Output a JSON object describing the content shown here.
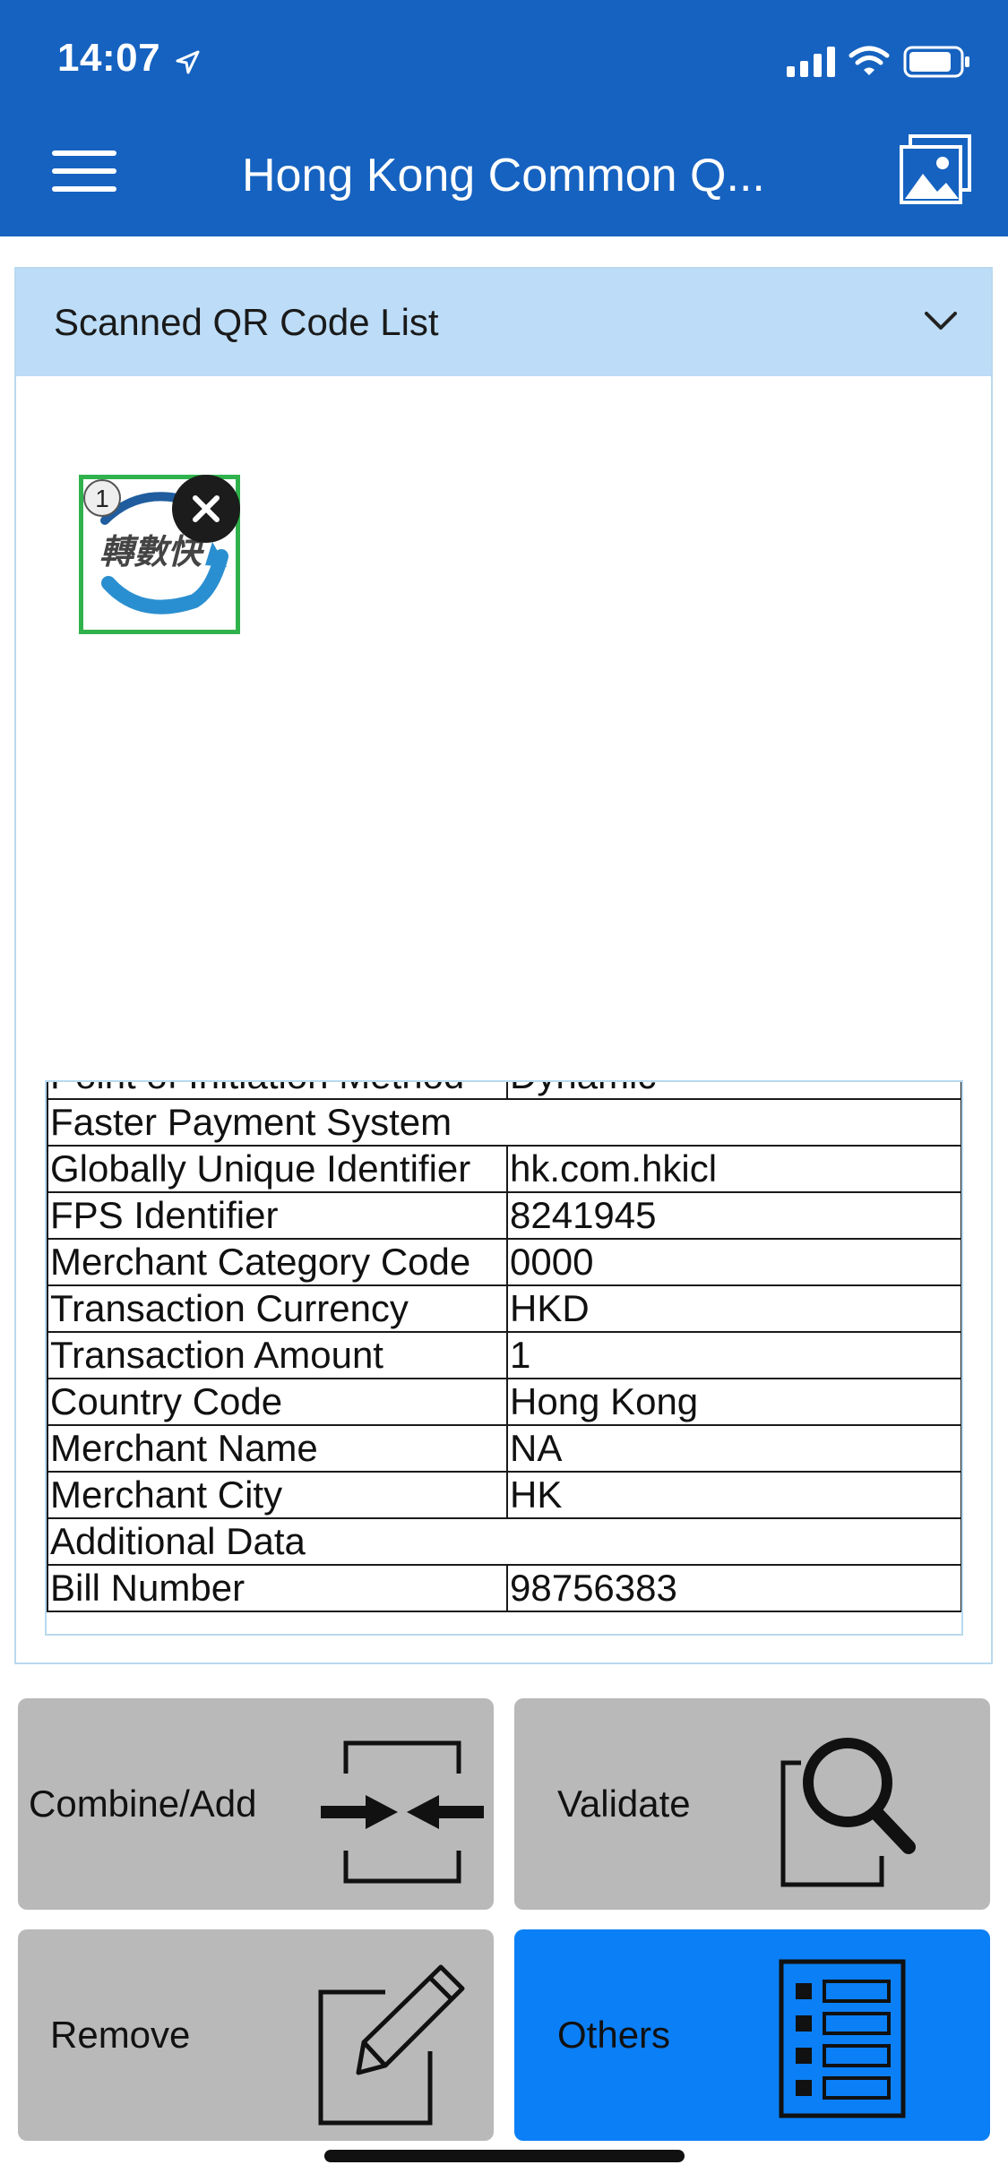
{
  "status_bar": {
    "time": "14:07"
  },
  "nav": {
    "title": "Hong Kong Common Q..."
  },
  "panel": {
    "title": "Scanned QR Code List"
  },
  "thumbnails": [
    {
      "index": "1",
      "logo_text": "轉數快"
    }
  ],
  "table": {
    "partial_row": {
      "label": "Point of Initiation Method",
      "value": "Dynamic"
    },
    "rows": [
      {
        "label": "Faster Payment System",
        "value": ""
      },
      {
        "label": "Globally Unique Identifier",
        "value": "hk.com.hkicl"
      },
      {
        "label": "FPS Identifier",
        "value": "8241945"
      },
      {
        "label": "Merchant Category Code",
        "value": "0000"
      },
      {
        "label": "Transaction Currency",
        "value": "HKD"
      },
      {
        "label": "Transaction Amount",
        "value": "1"
      },
      {
        "label": "Country Code",
        "value": "Hong Kong"
      },
      {
        "label": "Merchant Name",
        "value": "NA"
      },
      {
        "label": "Merchant City",
        "value": "HK"
      },
      {
        "label": "Additional Data",
        "value": ""
      },
      {
        "label": "Bill Number",
        "value": "98756383"
      }
    ]
  },
  "buttons": {
    "combine": "Combine/Add",
    "validate": "Validate",
    "remove": "Remove",
    "others": "Others"
  },
  "colors": {
    "nav_bg": "#1662c0",
    "panel_header_bg": "#bcdcf7",
    "button_bg": "#b9b9b9",
    "active_button_bg": "#0b7ff5",
    "thumb_border": "#2fb24c"
  },
  "icons": [
    "location-arrow-icon",
    "signal-icon",
    "wifi-icon",
    "battery-icon",
    "hamburger-menu-icon",
    "gallery-icon",
    "chevron-down-icon",
    "close-icon",
    "combine-arrows-icon",
    "magnifier-icon",
    "edit-pencil-icon",
    "list-icon"
  ]
}
